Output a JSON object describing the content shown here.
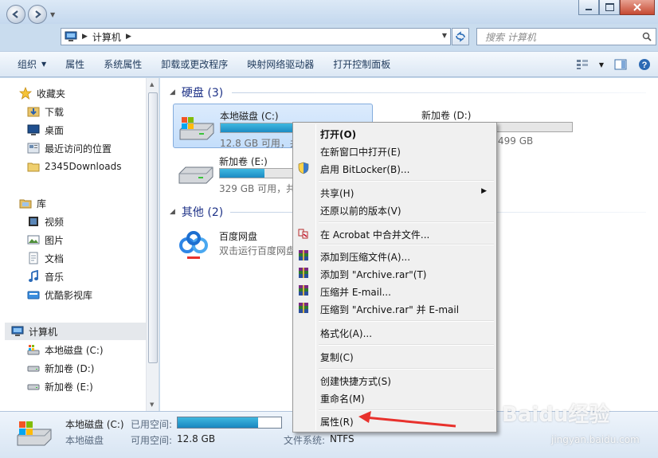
{
  "window": {
    "address_crumb": "计算机",
    "search_placeholder": "搜索 计算机"
  },
  "toolbar": {
    "organize": "组织",
    "properties": "属性",
    "system_properties": "系统属性",
    "uninstall": "卸载或更改程序",
    "map_drive": "映射网络驱动器",
    "control_panel": "打开控制面板"
  },
  "nav": {
    "favorites": "收藏夹",
    "downloads": "下载",
    "desktop": "桌面",
    "recent": "最近访问的位置",
    "folder_2345": "2345Downloads",
    "libraries": "库",
    "videos": "视频",
    "pictures": "图片",
    "documents": "文档",
    "music": "音乐",
    "youku": "优酷影视库",
    "computer": "计算机",
    "drive_c": "本地磁盘 (C:)",
    "drive_d": "新加卷 (D:)",
    "drive_e": "新加卷 (E:)"
  },
  "content": {
    "hard_disks_header": "硬盘 (3)",
    "other_header": "其他 (2)",
    "drives": [
      {
        "name": "本地磁盘 (C:)",
        "free": "12.8 GB 可用，共",
        "used_fraction": 0.78
      },
      {
        "name": "新加卷 (D:)",
        "free": "499 GB",
        "used_fraction": 0.0
      },
      {
        "name": "新加卷 (E:)",
        "free": "329 GB 可用，共",
        "used_fraction": 0.3
      }
    ],
    "apps": [
      {
        "name": "百度网盘",
        "desc": "双击运行百度网盘"
      }
    ]
  },
  "details": {
    "drive_name": "本地磁盘 (C:)",
    "drive_type": "本地磁盘",
    "used_label": "已用空间:",
    "free_label": "可用空间:",
    "free_value": "12.8 GB",
    "fs_label": "文件系统:",
    "fs_value": "NTFS",
    "used_fraction": 0.78
  },
  "menu": {
    "open": "打开(O)",
    "open_new_window": "在新窗口中打开(E)",
    "bitlocker": "启用 BitLocker(B)...",
    "share": "共享(H)",
    "restore": "还原以前的版本(V)",
    "acrobat": "在 Acrobat 中合并文件...",
    "add_archive": "添加到压缩文件(A)...",
    "add_rar": "添加到 \"Archive.rar\"(T)",
    "compress_email": "压缩并 E-mail...",
    "compress_rar_email": "压缩到 \"Archive.rar\" 并 E-mail",
    "format": "格式化(A)...",
    "copy": "复制(C)",
    "shortcut": "创建快捷方式(S)",
    "rename": "重命名(M)",
    "properties": "属性(R)"
  },
  "colors": {
    "accent": "#1e3287",
    "bar_fill": "#1c8bc3",
    "arrow": "#e8312c"
  },
  "watermark": {
    "brand": "Baidu经验",
    "url": "jingyan.baidu.com"
  }
}
